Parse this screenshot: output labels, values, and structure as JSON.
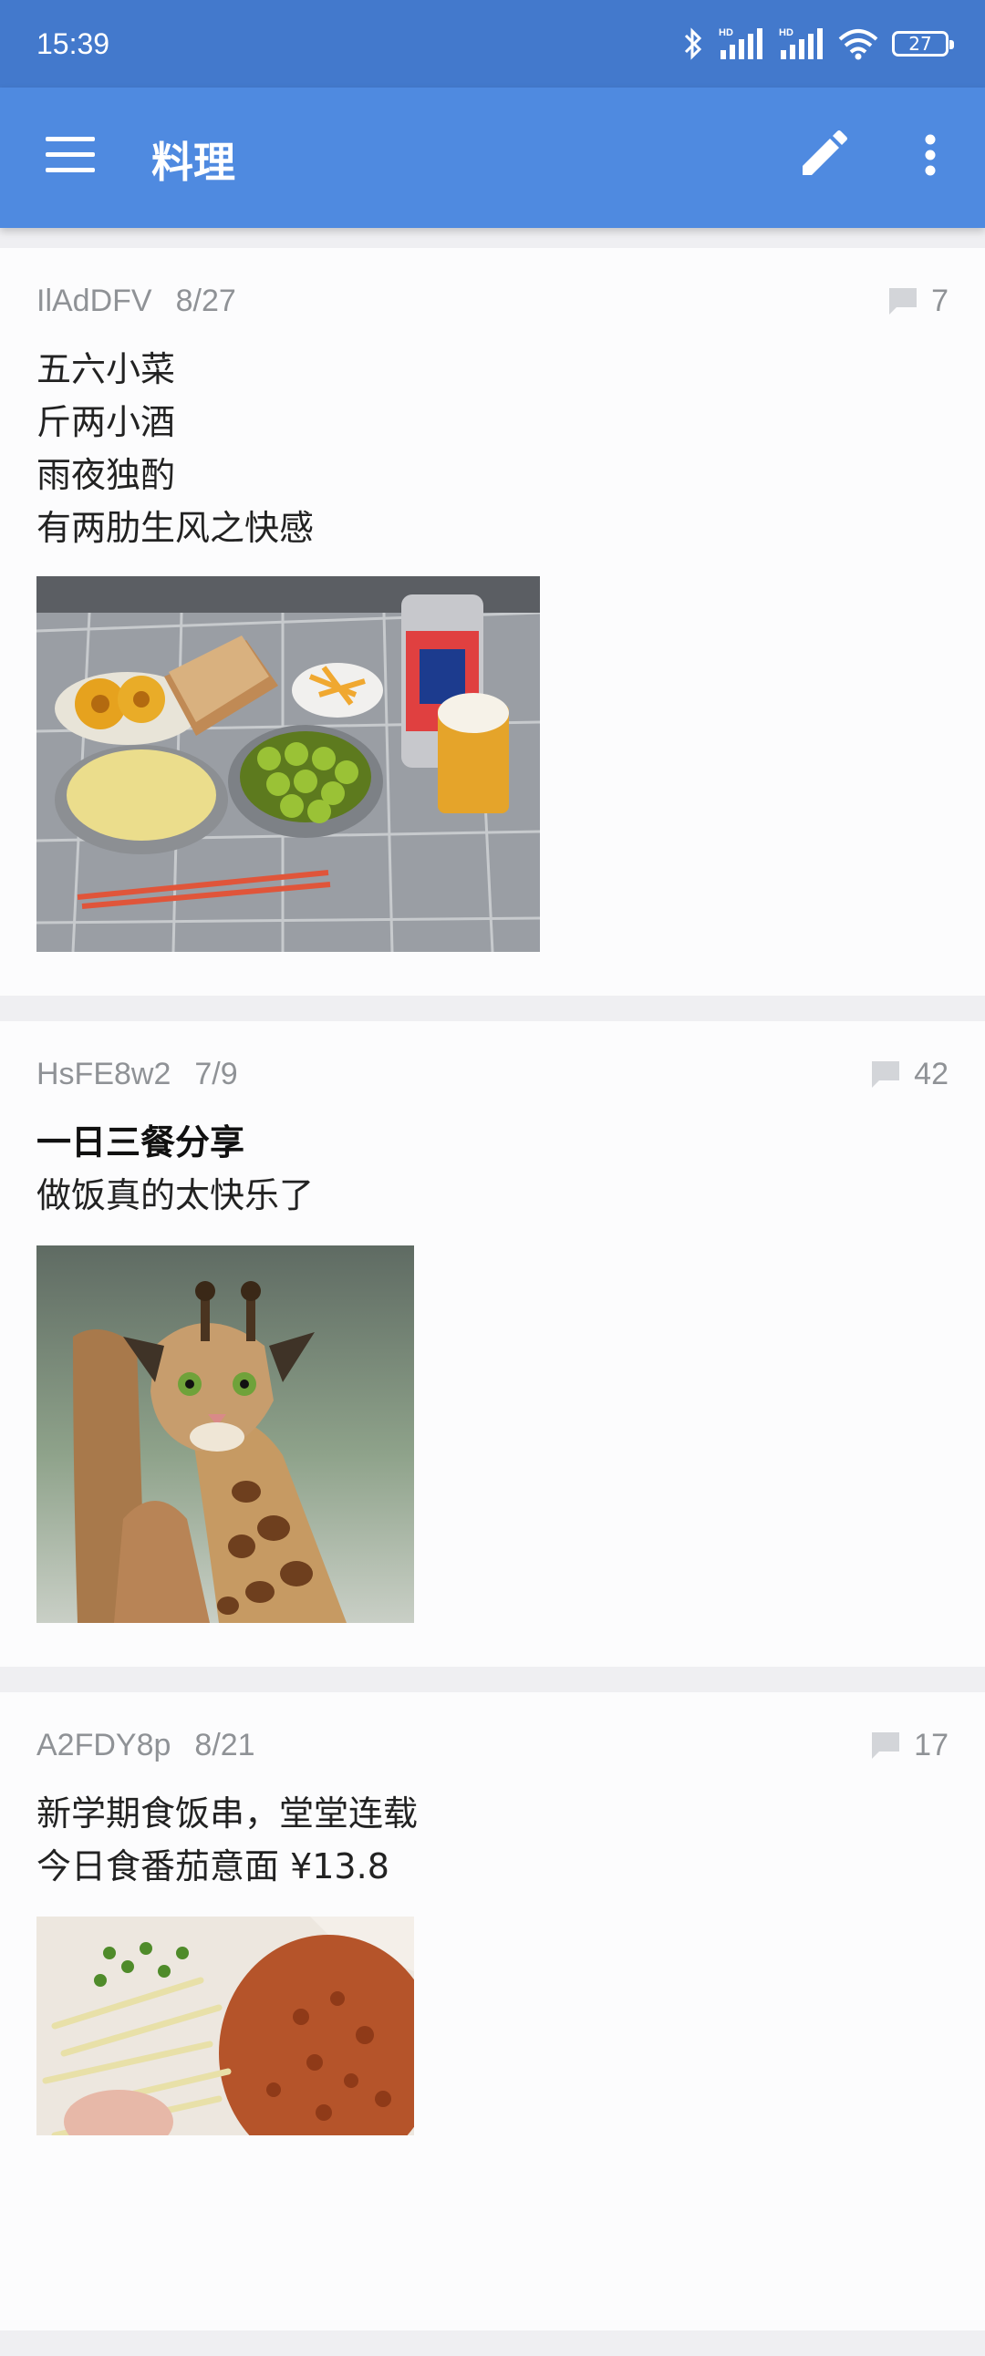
{
  "status_bar": {
    "time": "15:39",
    "battery": "27",
    "icons": [
      "bluetooth-icon",
      "signal-hd-icon",
      "signal-hd-icon",
      "wifi-icon",
      "battery-icon"
    ]
  },
  "app_bar": {
    "title": "料理",
    "menu_icon": "hamburger-menu-icon",
    "edit_icon": "pencil-icon",
    "more_icon": "more-vert-icon",
    "color": "#4f8ae0"
  },
  "posts": [
    {
      "author": "IlAdDFV",
      "date": "8/27",
      "comment_count": "7",
      "lines": [
        "五六小菜",
        "斤两小酒",
        "雨夜独酌",
        "有两肋生风之快感"
      ]
    },
    {
      "author": "HsFE8w2",
      "date": "7/9",
      "comment_count": "42",
      "title": "一日三餐分享",
      "lines": [
        "做饭真的太快乐了"
      ]
    },
    {
      "author": "A2FDY8p",
      "date": "8/21",
      "comment_count": "17",
      "lines": [
        "新学期食饭串，堂堂连载",
        "今日食番茄意面 ¥13.8"
      ]
    }
  ]
}
